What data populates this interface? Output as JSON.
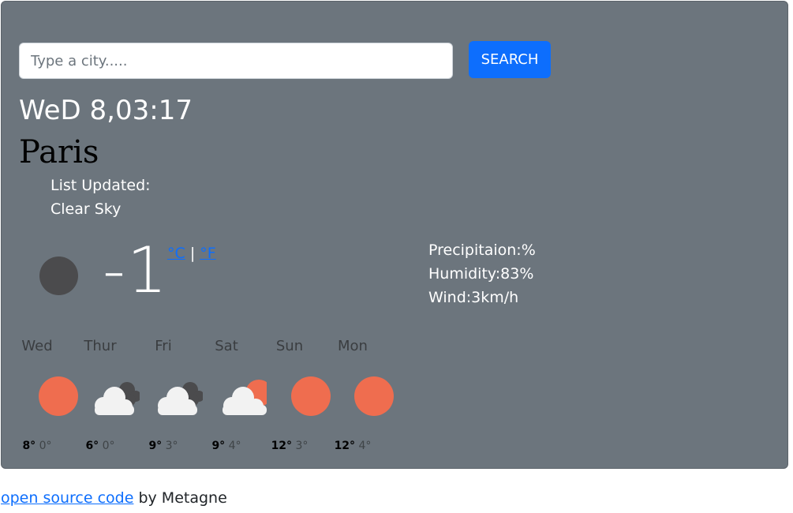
{
  "search": {
    "placeholder": "Type a city.....",
    "button_label": "SEARCH"
  },
  "current": {
    "datetime": "WeD 8,03:17",
    "city": "Paris",
    "list_updated": "List Updated:",
    "condition": "Clear Sky",
    "icon": "moon-icon",
    "temperature": "-1",
    "unit_c": "°C",
    "unit_sep": "|",
    "unit_f": "°F",
    "precipitation": "Precipitaion:%",
    "humidity": "Humidity:83%",
    "wind": "Wind:3km/h"
  },
  "forecast": [
    {
      "day": "Wed",
      "icon": "sun-icon",
      "max": "8°",
      "min": "0°"
    },
    {
      "day": "Thur",
      "icon": "cloudy-dark-icon",
      "max": "6°",
      "min": "0°"
    },
    {
      "day": "Fri",
      "icon": "cloudy-dark-icon",
      "max": "9°",
      "min": "3°"
    },
    {
      "day": "Sat",
      "icon": "partly-sunny-icon",
      "max": "9°",
      "min": "4°"
    },
    {
      "day": "Sun",
      "icon": "sun-icon",
      "max": "12°",
      "min": "3°"
    },
    {
      "day": "Mon",
      "icon": "sun-icon",
      "max": "12°",
      "min": "4°"
    }
  ],
  "footer": {
    "link_text": "open source code",
    "suffix": " by Metagne"
  },
  "colors": {
    "card_bg": "#6c757d",
    "accent": "#0d6efd",
    "sun": "#ef6d4f",
    "cloud": "#f2f2f2",
    "dark_cloud": "#4b4b4d"
  }
}
